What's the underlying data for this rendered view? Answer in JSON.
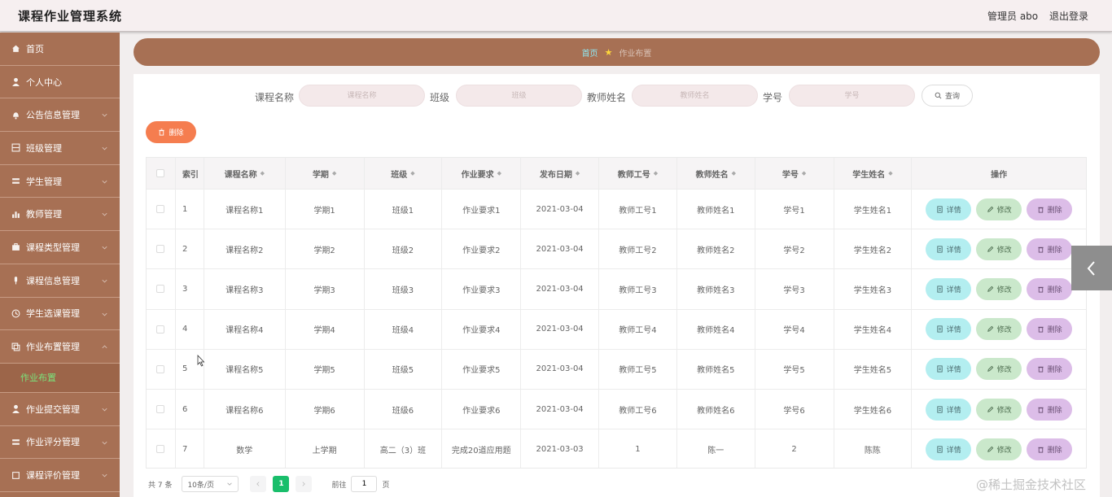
{
  "header": {
    "title": "课程作业管理系统",
    "user": "管理员 abo",
    "logout": "退出登录"
  },
  "sidebar": {
    "items": [
      {
        "label": "首页",
        "icon": "home-icon"
      },
      {
        "label": "个人中心",
        "icon": "user-icon"
      },
      {
        "label": "公告信息管理",
        "icon": "bell-icon"
      },
      {
        "label": "班级管理",
        "icon": "grid-icon"
      },
      {
        "label": "学生管理",
        "icon": "list-icon"
      },
      {
        "label": "教师管理",
        "icon": "chart-icon"
      },
      {
        "label": "课程类型管理",
        "icon": "briefcase-icon"
      },
      {
        "label": "课程信息管理",
        "icon": "mic-icon"
      },
      {
        "label": "学生选课管理",
        "icon": "clock-icon"
      },
      {
        "label": "作业布置管理",
        "icon": "copy-icon"
      }
    ],
    "active_sub": "作业布置",
    "items_after": [
      {
        "label": "作业提交管理",
        "icon": "user-icon"
      },
      {
        "label": "作业评分管理",
        "icon": "list-icon"
      },
      {
        "label": "课程评价管理",
        "icon": "square-icon"
      }
    ]
  },
  "breadcrumb": {
    "home": "首页",
    "current": "作业布置"
  },
  "search": {
    "course_label": "课程名称",
    "course_placeholder": "课程名称",
    "class_label": "班级",
    "class_placeholder": "班级",
    "teacher_label": "教师姓名",
    "teacher_placeholder": "教师姓名",
    "student_no_label": "学号",
    "student_no_placeholder": "学号",
    "query": "查询"
  },
  "batch_delete": "删除",
  "table": {
    "headers": [
      "索引",
      "课程名称",
      "学期",
      "班级",
      "作业要求",
      "发布日期",
      "教师工号",
      "教师姓名",
      "学号",
      "学生姓名",
      "操作"
    ],
    "rows": [
      [
        "1",
        "课程名称1",
        "学期1",
        "班级1",
        "作业要求1",
        "2021-03-04",
        "教师工号1",
        "教师姓名1",
        "学号1",
        "学生姓名1"
      ],
      [
        "2",
        "课程名称2",
        "学期2",
        "班级2",
        "作业要求2",
        "2021-03-04",
        "教师工号2",
        "教师姓名2",
        "学号2",
        "学生姓名2"
      ],
      [
        "3",
        "课程名称3",
        "学期3",
        "班级3",
        "作业要求3",
        "2021-03-04",
        "教师工号3",
        "教师姓名3",
        "学号3",
        "学生姓名3"
      ],
      [
        "4",
        "课程名称4",
        "学期4",
        "班级4",
        "作业要求4",
        "2021-03-04",
        "教师工号4",
        "教师姓名4",
        "学号4",
        "学生姓名4"
      ],
      [
        "5",
        "课程名称5",
        "学期5",
        "班级5",
        "作业要求5",
        "2021-03-04",
        "教师工号5",
        "教师姓名5",
        "学号5",
        "学生姓名5"
      ],
      [
        "6",
        "课程名称6",
        "学期6",
        "班级6",
        "作业要求6",
        "2021-03-04",
        "教师工号6",
        "教师姓名6",
        "学号6",
        "学生姓名6"
      ],
      [
        "7",
        "数学",
        "上学期",
        "高二（3）班",
        "完成20道应用题",
        "2021-03-03",
        "1",
        "陈一",
        "2",
        "陈陈"
      ]
    ],
    "actions": {
      "detail": "详情",
      "edit": "修改",
      "delete": "删除"
    }
  },
  "pagination": {
    "total": "共 7 条",
    "page_size": "10条/页",
    "current_page": "1",
    "goto_label": "前往",
    "goto_value": "1",
    "page_suffix": "页"
  },
  "watermark": "@稀土掘金技术社区",
  "colors": {
    "sidebar": "#a77054",
    "accent_green": "#19be6b",
    "delete_orange": "#f57d4f"
  }
}
